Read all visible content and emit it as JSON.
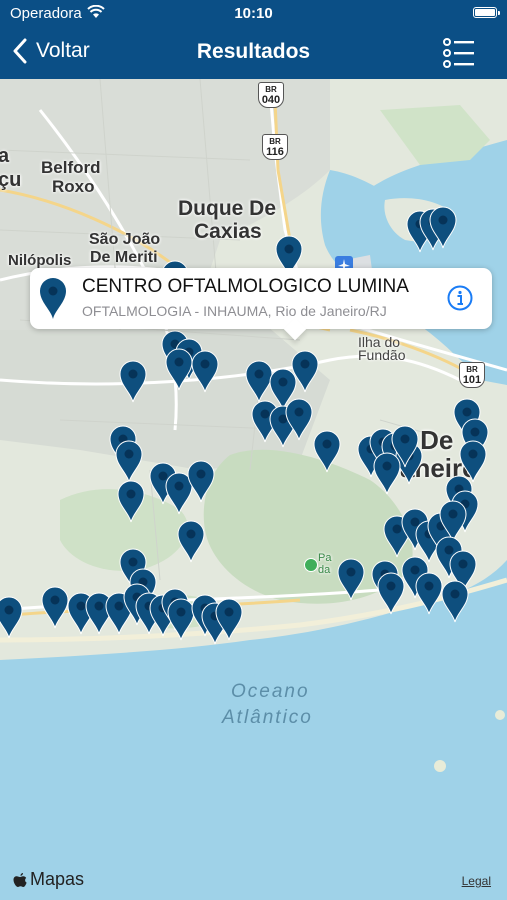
{
  "status_bar": {
    "carrier": "Operadora",
    "time": "10:10"
  },
  "nav": {
    "back_label": "Voltar",
    "title": "Resultados"
  },
  "callout": {
    "name": "CENTRO OFTALMOLOGICO LUMINA",
    "subtitle": "OFTALMOLOGIA - INHAUMA, Rio de Janeiro/RJ"
  },
  "map": {
    "labels": {
      "ria": "a",
      "icu": "çu",
      "belford": "Belford",
      "roxo": "Roxo",
      "duque": "Duque De",
      "caxias": "Caxias",
      "sao_joao": "São João",
      "de_meriti": "De Meriti",
      "nilopolis": "Nilópolis",
      "ilha": "Ilha do",
      "fundao": "Fundão",
      "rio_de": "o De",
      "janeiro": "aneiro",
      "parque": "Pa",
      "parque2": "da",
      "oceano": "Oceano",
      "atlantico": "Atlântico"
    },
    "shields": [
      {
        "route": "BR",
        "number": "040"
      },
      {
        "route": "BR",
        "number": "116"
      },
      {
        "route": "BR",
        "number": "101"
      }
    ],
    "pin_color": "#0e4f7e",
    "water_color": "#9fd2e8"
  },
  "footer": {
    "brand": "Mapas",
    "legal": "Legal"
  }
}
